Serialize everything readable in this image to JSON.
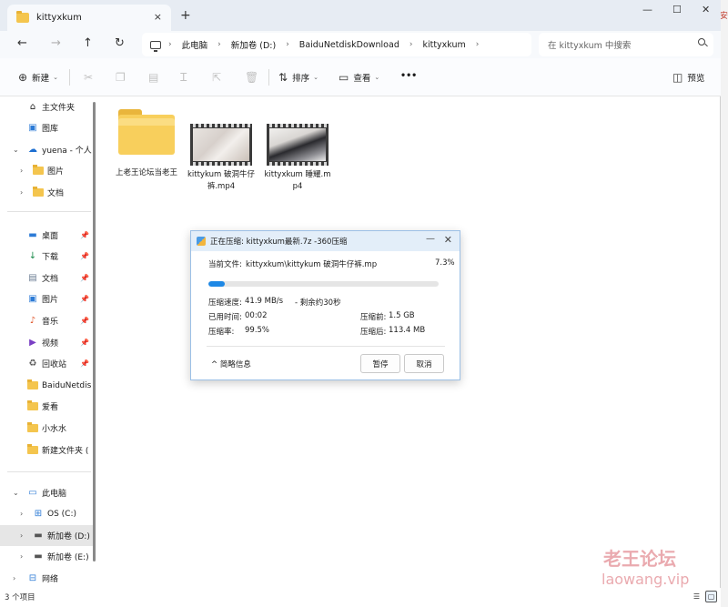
{
  "window": {
    "tab_title": "kittyxkum",
    "tab_close": "×",
    "new_tab": "+",
    "controls": {
      "minimize": "—",
      "maximize": "☐",
      "close": "✕"
    }
  },
  "nav": {
    "back": "←",
    "forward": "→",
    "up": "↑",
    "refresh": "↻"
  },
  "breadcrumb": [
    "此电脑",
    "新加卷 (D:)",
    "BaiduNetdiskDownload",
    "kittyxkum"
  ],
  "search": {
    "placeholder": "在 kittyxkum 中搜索"
  },
  "toolbar": {
    "new_label": "新建",
    "sort_label": "排序",
    "view_label": "查看",
    "more_label": "•••",
    "preview_label": "预览"
  },
  "sidebar": {
    "top_items": [
      {
        "label": "主文件夹",
        "icon": "home-icon"
      },
      {
        "label": "图库",
        "icon": "gallery-icon"
      },
      {
        "label": "yuena - 个人",
        "icon": "onedrive-icon"
      },
      {
        "label": "图片",
        "icon": "folder-icon"
      },
      {
        "label": "文档",
        "icon": "folder-icon"
      }
    ],
    "pinned_items": [
      {
        "label": "桌面",
        "icon": "desktop-icon"
      },
      {
        "label": "下载",
        "icon": "download-icon"
      },
      {
        "label": "文档",
        "icon": "document-icon"
      },
      {
        "label": "图片",
        "icon": "picture-icon"
      },
      {
        "label": "音乐",
        "icon": "music-icon"
      },
      {
        "label": "视频",
        "icon": "video-icon"
      },
      {
        "label": "回收站",
        "icon": "recycle-bin-icon"
      },
      {
        "label": "BaiduNetdis",
        "icon": "folder-icon"
      },
      {
        "label": "爱看",
        "icon": "folder-icon"
      },
      {
        "label": "小水水",
        "icon": "folder-icon"
      },
      {
        "label": "新建文件夹 (",
        "icon": "folder-icon"
      }
    ],
    "pc_items": [
      {
        "label": "此电脑",
        "icon": "pc-icon"
      },
      {
        "label": "OS (C:)",
        "icon": "drive-icon"
      },
      {
        "label": "新加卷 (D:)",
        "icon": "drive-icon"
      },
      {
        "label": "新加卷 (E:)",
        "icon": "drive-icon"
      },
      {
        "label": "网络",
        "icon": "network-icon"
      }
    ]
  },
  "files": [
    {
      "name": "上老王论坛当老王",
      "type": "folder"
    },
    {
      "name": "kittykum 破洞牛仔裤.mp4",
      "type": "video"
    },
    {
      "name": "kittyxkum 睡耀.mp4",
      "type": "video"
    }
  ],
  "dialog": {
    "title": "正在压缩: kittyxkum最新.7z -360压缩",
    "current_file_label": "当前文件:",
    "current_file": "kittyxkum\\kittykum 破洞牛仔裤.mp",
    "percent_text": "7.3%",
    "progress": 0.073,
    "speed_label": "压缩速度:",
    "speed": "41.9 MB/s",
    "remaining": "- 剩余约30秒",
    "elapsed_label": "已用时间:",
    "elapsed": "00:02",
    "ratio_label": "压缩率:",
    "ratio": "99.5%",
    "before_label": "压缩前:",
    "before": "1.5 GB",
    "after_label": "压缩后:",
    "after": "113.4 MB",
    "brief_toggle": "简略信息",
    "pause_button": "暂停",
    "cancel_button": "取消"
  },
  "status": {
    "item_count": "3 个项目"
  },
  "watermark": {
    "line1": "老王论坛",
    "line2": "laowang.vip"
  }
}
